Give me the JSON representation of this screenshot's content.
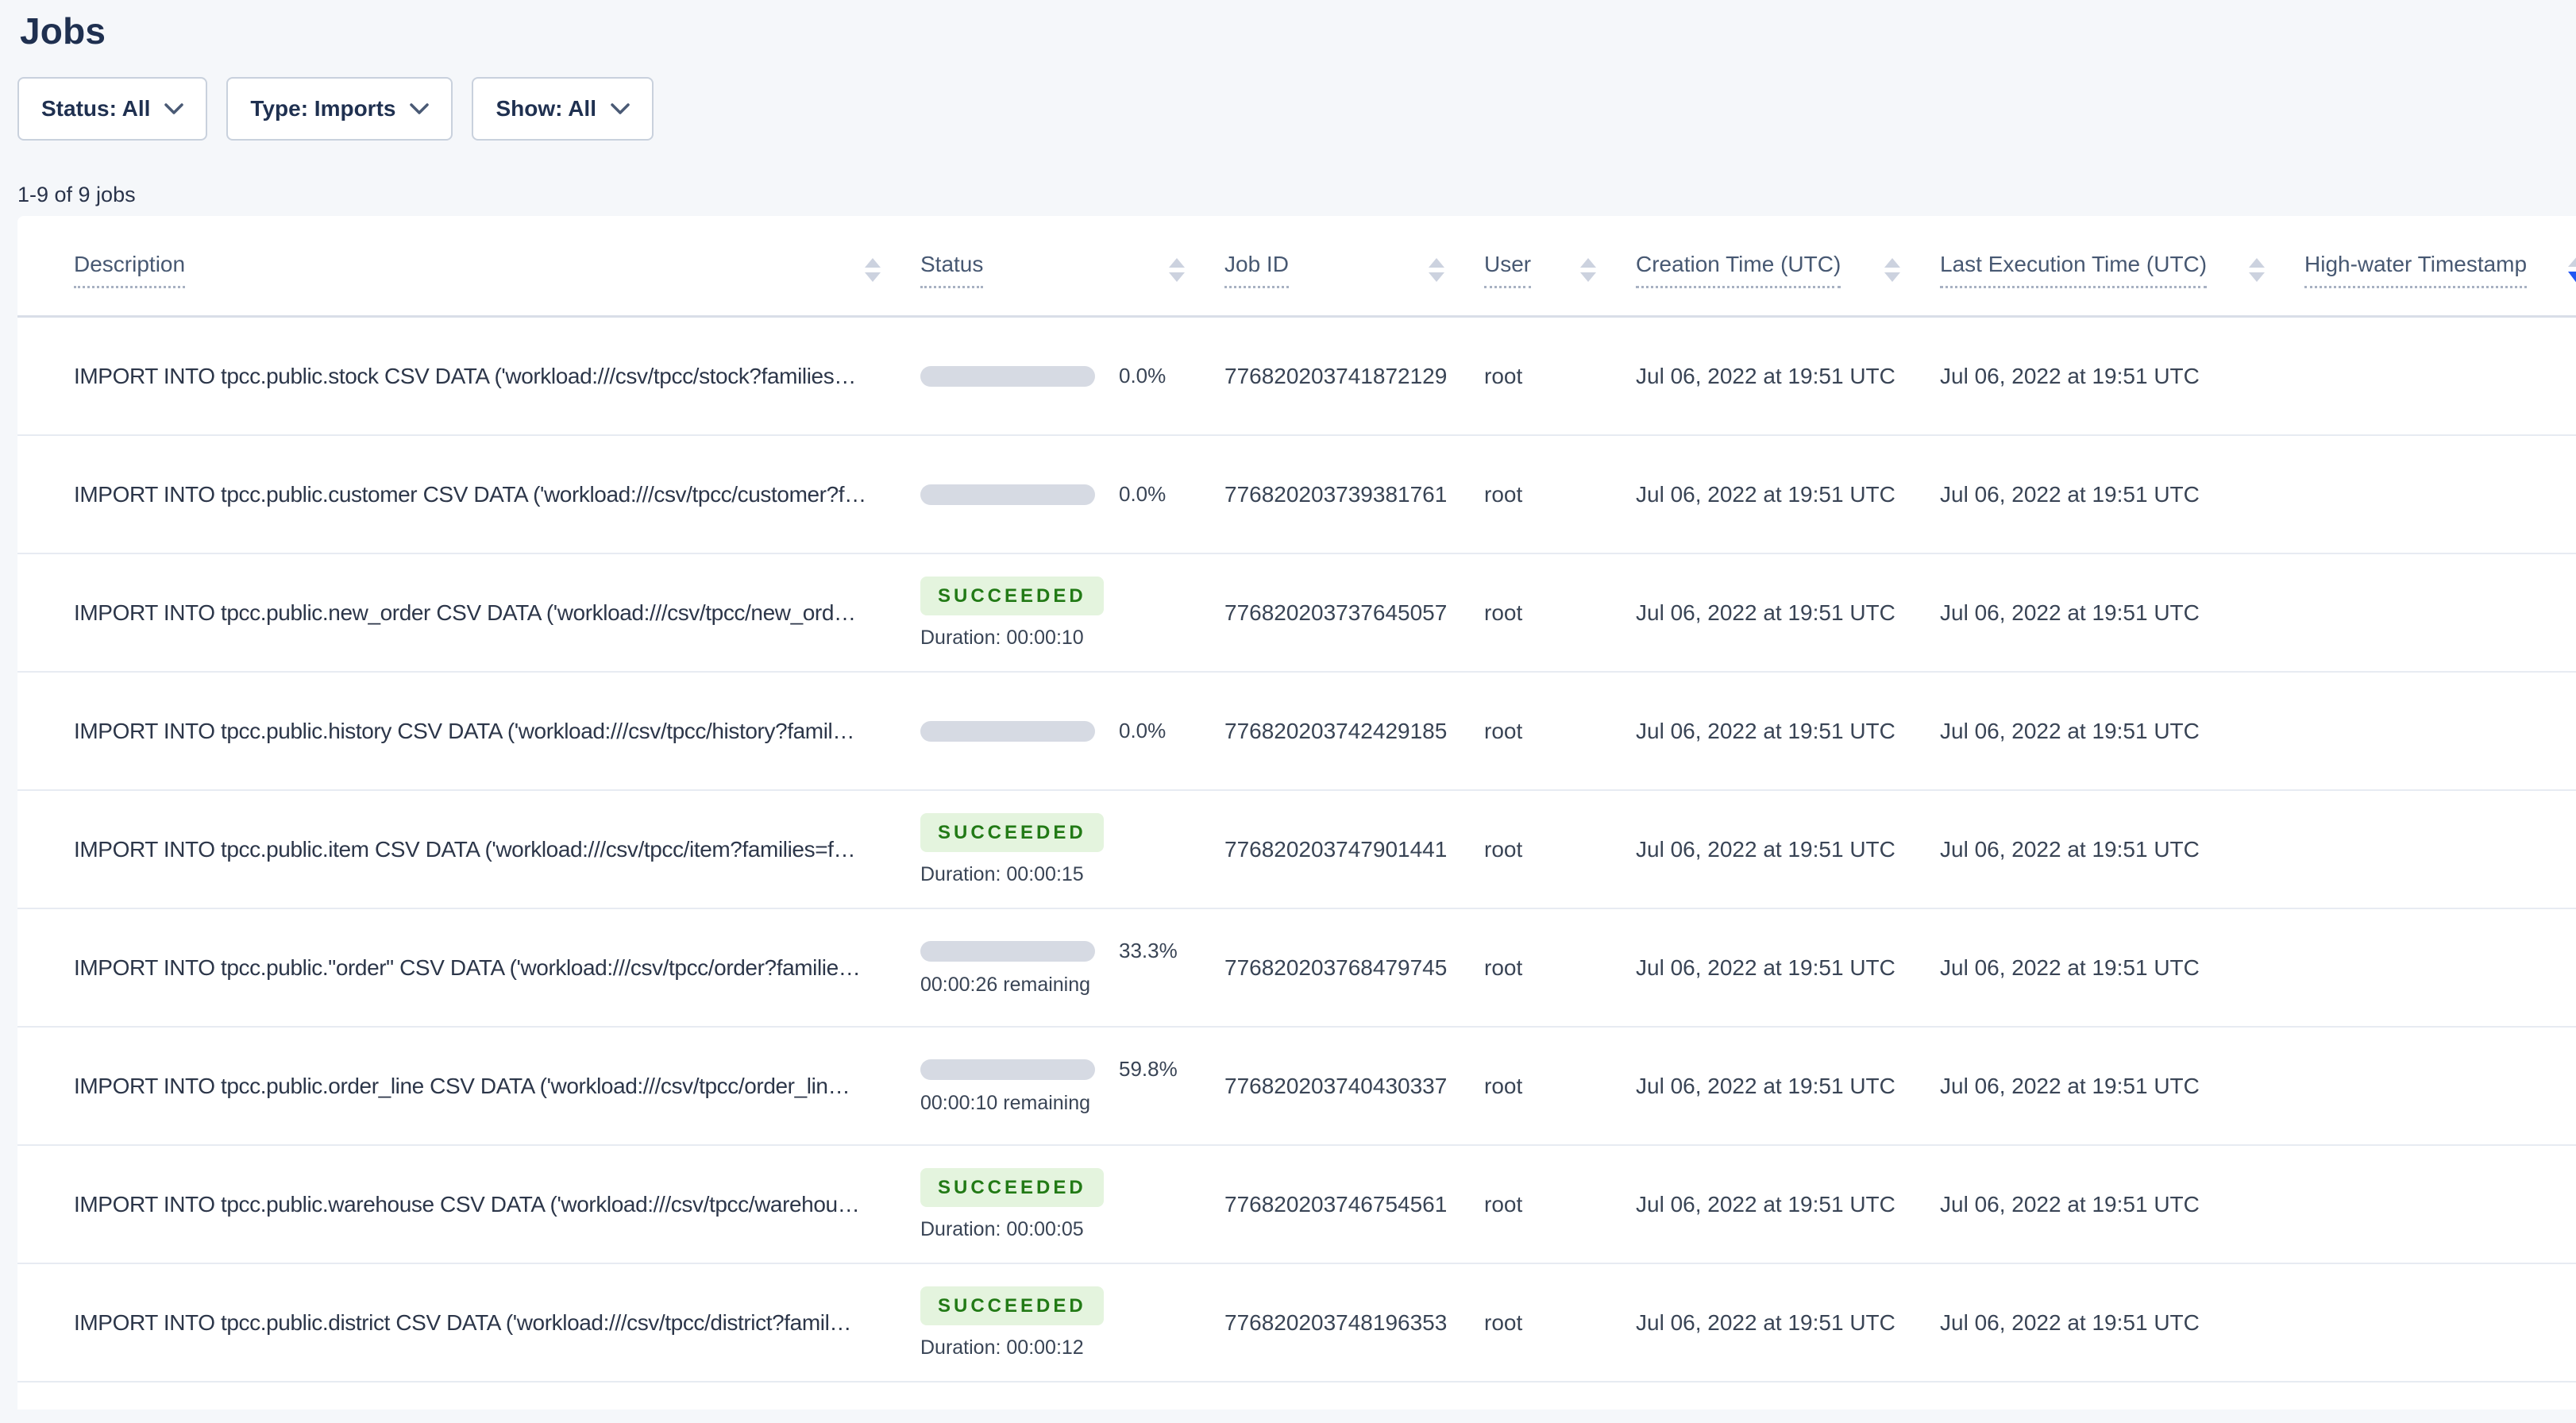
{
  "page": {
    "title": "Jobs",
    "count_label": "1-9 of 9 jobs"
  },
  "filters": {
    "status": {
      "label": "Status: All"
    },
    "type": {
      "label": "Type: Imports"
    },
    "show": {
      "label": "Show: All"
    }
  },
  "table": {
    "columns": [
      {
        "label": "Description",
        "sort_active": false
      },
      {
        "label": "Status",
        "sort_active": false
      },
      {
        "label": "Job ID",
        "sort_active": false
      },
      {
        "label": "User",
        "sort_active": false
      },
      {
        "label": "Creation Time (UTC)",
        "sort_active": false
      },
      {
        "label": "Last Execution Time (UTC)",
        "sort_active": false
      },
      {
        "label": "High-water Timestamp",
        "sort_active": true
      }
    ],
    "sort": {
      "active_column": "High-water Timestamp",
      "direction": "desc"
    },
    "rows": [
      {
        "description": "IMPORT INTO tpcc.public.stock CSV DATA ('workload:///csv/tpcc/stock?families…",
        "status": "running",
        "percent": 0,
        "percent_label": "0.0%",
        "sub": "",
        "job_id": "776820203741872129",
        "user": "root",
        "creation_time": "Jul 06, 2022 at 19:51 UTC",
        "last_execution_time": "Jul 06, 2022 at 19:51 UTC",
        "high_water_timestamp": ""
      },
      {
        "description": "IMPORT INTO tpcc.public.customer CSV DATA ('workload:///csv/tpcc/customer?f…",
        "status": "running",
        "percent": 0,
        "percent_label": "0.0%",
        "sub": "",
        "job_id": "776820203739381761",
        "user": "root",
        "creation_time": "Jul 06, 2022 at 19:51 UTC",
        "last_execution_time": "Jul 06, 2022 at 19:51 UTC",
        "high_water_timestamp": ""
      },
      {
        "description": "IMPORT INTO tpcc.public.new_order CSV DATA ('workload:///csv/tpcc/new_ord…",
        "status": "succeeded",
        "badge": "SUCCEEDED",
        "sub": "Duration: 00:00:10",
        "job_id": "776820203737645057",
        "user": "root",
        "creation_time": "Jul 06, 2022 at 19:51 UTC",
        "last_execution_time": "Jul 06, 2022 at 19:51 UTC",
        "high_water_timestamp": ""
      },
      {
        "description": "IMPORT INTO tpcc.public.history CSV DATA ('workload:///csv/tpcc/history?famil…",
        "status": "running",
        "percent": 0,
        "percent_label": "0.0%",
        "sub": "",
        "job_id": "776820203742429185",
        "user": "root",
        "creation_time": "Jul 06, 2022 at 19:51 UTC",
        "last_execution_time": "Jul 06, 2022 at 19:51 UTC",
        "high_water_timestamp": ""
      },
      {
        "description": "IMPORT INTO tpcc.public.item CSV DATA ('workload:///csv/tpcc/item?families=f…",
        "status": "succeeded",
        "badge": "SUCCEEDED",
        "sub": "Duration: 00:00:15",
        "job_id": "776820203747901441",
        "user": "root",
        "creation_time": "Jul 06, 2022 at 19:51 UTC",
        "last_execution_time": "Jul 06, 2022 at 19:51 UTC",
        "high_water_timestamp": ""
      },
      {
        "description": "IMPORT INTO tpcc.public.\"order\" CSV DATA ('workload:///csv/tpcc/order?familie…",
        "status": "running",
        "percent": 33.3,
        "percent_label": "33.3%",
        "sub": "00:00:26 remaining",
        "job_id": "776820203768479745",
        "user": "root",
        "creation_time": "Jul 06, 2022 at 19:51 UTC",
        "last_execution_time": "Jul 06, 2022 at 19:51 UTC",
        "high_water_timestamp": ""
      },
      {
        "description": "IMPORT INTO tpcc.public.order_line CSV DATA ('workload:///csv/tpcc/order_lin…",
        "status": "running",
        "percent": 59.8,
        "percent_label": "59.8%",
        "sub": "00:00:10 remaining",
        "job_id": "776820203740430337",
        "user": "root",
        "creation_time": "Jul 06, 2022 at 19:51 UTC",
        "last_execution_time": "Jul 06, 2022 at 19:51 UTC",
        "high_water_timestamp": ""
      },
      {
        "description": "IMPORT INTO tpcc.public.warehouse CSV DATA ('workload:///csv/tpcc/warehou…",
        "status": "succeeded",
        "badge": "SUCCEEDED",
        "sub": "Duration: 00:00:05",
        "job_id": "776820203746754561",
        "user": "root",
        "creation_time": "Jul 06, 2022 at 19:51 UTC",
        "last_execution_time": "Jul 06, 2022 at 19:51 UTC",
        "high_water_timestamp": ""
      },
      {
        "description": "IMPORT INTO tpcc.public.district CSV DATA ('workload:///csv/tpcc/district?famil…",
        "status": "succeeded",
        "badge": "SUCCEEDED",
        "sub": "Duration: 00:00:12",
        "job_id": "776820203748196353",
        "user": "root",
        "creation_time": "Jul 06, 2022 at 19:51 UTC",
        "last_execution_time": "Jul 06, 2022 at 19:51 UTC",
        "high_water_timestamp": ""
      }
    ]
  },
  "colors": {
    "page_background": "#f5f7fa",
    "progress_fill": "#0e57fb",
    "progress_track": "#d6dae3",
    "badge_background": "#e4f4de",
    "badge_text": "#227a16",
    "active_sort_arrow": "#2457f2"
  }
}
